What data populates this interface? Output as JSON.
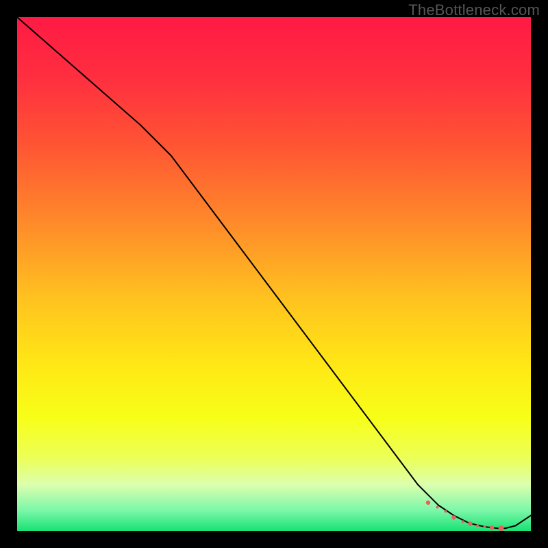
{
  "watermark": "TheBottleneck.com",
  "chart_data": {
    "type": "line",
    "title": "",
    "xlabel": "",
    "ylabel": "",
    "xlim": [
      0,
      100
    ],
    "ylim": [
      0,
      100
    ],
    "grid": false,
    "legend": false,
    "background_gradient": {
      "stops": [
        {
          "offset": 0.0,
          "color": "#ff1a44"
        },
        {
          "offset": 0.12,
          "color": "#ff2f3f"
        },
        {
          "offset": 0.25,
          "color": "#ff5533"
        },
        {
          "offset": 0.4,
          "color": "#ff8a2a"
        },
        {
          "offset": 0.55,
          "color": "#ffc31f"
        },
        {
          "offset": 0.68,
          "color": "#ffe815"
        },
        {
          "offset": 0.78,
          "color": "#f7ff18"
        },
        {
          "offset": 0.86,
          "color": "#ecff5a"
        },
        {
          "offset": 0.91,
          "color": "#dcffae"
        },
        {
          "offset": 0.96,
          "color": "#7cf7a9"
        },
        {
          "offset": 1.0,
          "color": "#18e274"
        }
      ]
    },
    "series": [
      {
        "name": "bottleneck-curve",
        "color": "#000000",
        "stroke_width": 2,
        "x": [
          0,
          8,
          16,
          24,
          30,
          36,
          42,
          48,
          54,
          60,
          66,
          72,
          78,
          82,
          85,
          88,
          91,
          93.5,
          95,
          97,
          100
        ],
        "values": [
          100,
          93,
          86,
          79,
          73,
          65,
          57,
          49,
          41,
          33,
          25,
          17,
          9,
          5,
          3,
          1.5,
          0.8,
          0.5,
          0.5,
          1.0,
          3.0
        ]
      }
    ],
    "markers": {
      "name": "valley-dots",
      "color": "#e2645f",
      "radius_pattern": [
        3.2,
        2.0,
        2.0,
        3.2,
        2.0,
        3.2,
        2.0,
        2.0,
        3.2,
        4.0
      ],
      "x": [
        80.0,
        81.8,
        83.4,
        85.0,
        86.8,
        88.2,
        89.6,
        91.0,
        92.4,
        94.2
      ],
      "y": [
        5.5,
        4.6,
        3.8,
        2.6,
        1.8,
        1.4,
        1.0,
        0.8,
        0.6,
        0.5
      ]
    }
  }
}
